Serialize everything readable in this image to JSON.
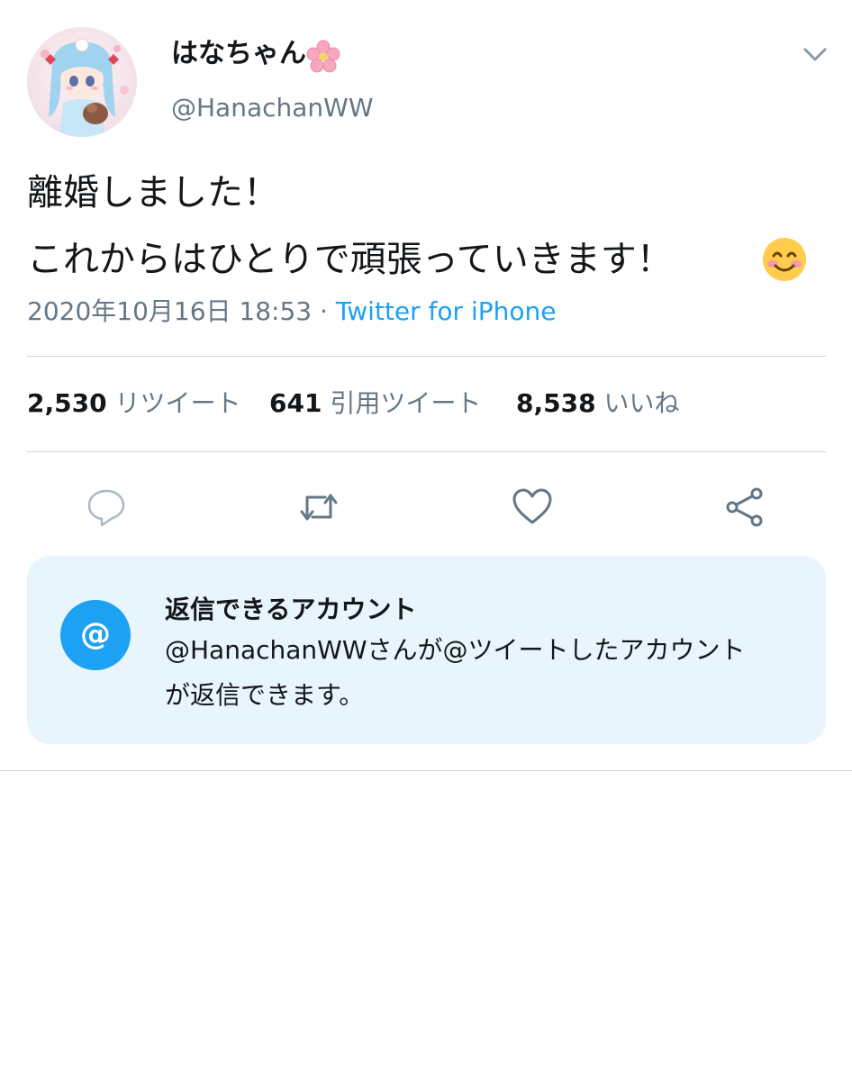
{
  "tweet": {
    "display_name": "はなちゃん",
    "display_name_emoji": "cherry-blossom",
    "handle": "@HanachanWW",
    "text_line1": "離婚しました！",
    "text_line2": "これからはひとりで頑張っていきます！",
    "text_emoji": "smiling-face-with-smiling-eyes",
    "timestamp": "2020年10月16日 18:53",
    "separator": " · ",
    "source": "Twitter for iPhone"
  },
  "stats": {
    "retweets_count": "2,530",
    "retweets_label": "リツイート",
    "quotes_count": "641",
    "quotes_label": "引用ツイート",
    "likes_count": "8,538",
    "likes_label": "いいね"
  },
  "actions": {
    "icons": [
      "reply-icon",
      "retweet-icon",
      "like-icon",
      "share-icon"
    ]
  },
  "reply_restriction": {
    "icon_glyph": "@",
    "title": "返信できるアカウント",
    "description_line1": "@HanachanWWさんが@ツイートしたアカウント",
    "description_line2": "が返信できます。"
  },
  "colors": {
    "accent": "#1da1f2",
    "secondary_text": "#657786",
    "reply_box_bg": "#e8f5fd",
    "divider": "#ccd6dd"
  }
}
